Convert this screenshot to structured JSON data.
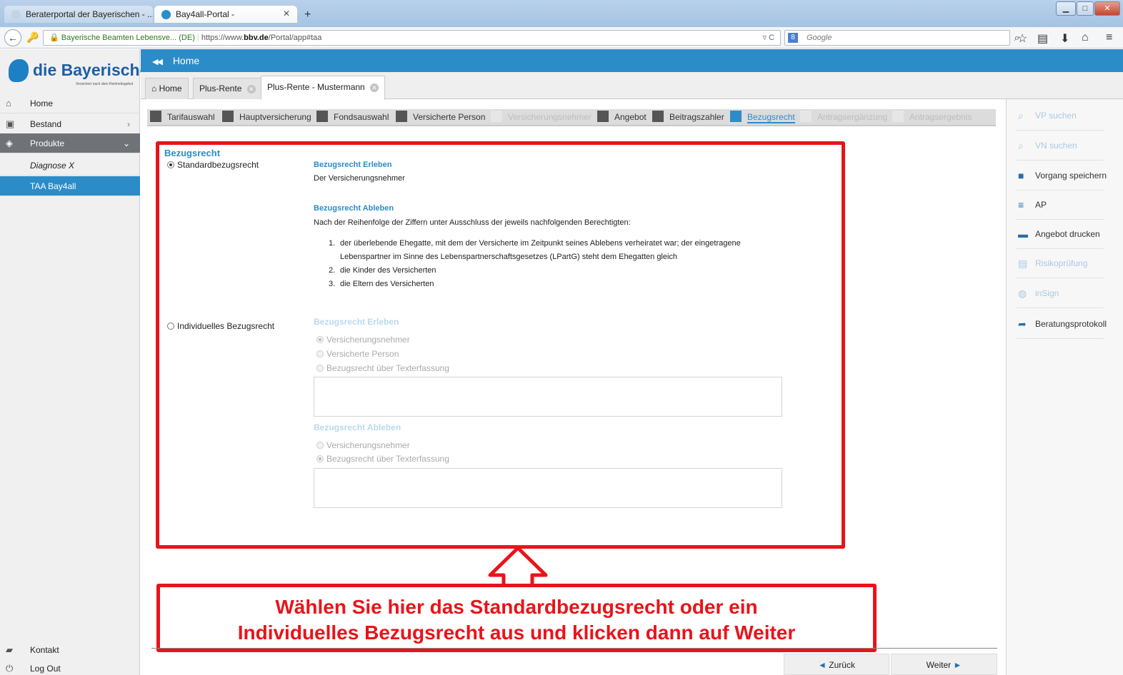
{
  "browser": {
    "tabs": [
      {
        "title": "Beraterportal der Bayerischen - ..."
      },
      {
        "title": "Bay4all-Portal -"
      }
    ],
    "new_tab": "+",
    "url_site": "Bayerische Beamten Lebensve... (DE)",
    "url_prefix": "https://www.",
    "url_domain": "bbv.de",
    "url_path": "/Portal/app#taa",
    "search_placeholder": "Google"
  },
  "sidebar": {
    "logo_name": "die Bayerische",
    "logo_claim": "Versichert nach dem Reinheitsgebot",
    "items": [
      {
        "label": "Home",
        "icon": "home-icon"
      },
      {
        "label": "Bestand",
        "icon": "folder-icon"
      },
      {
        "label": "Produkte",
        "icon": "layers-icon"
      },
      {
        "label": "Diagnose X"
      },
      {
        "label": "TAA Bay4all"
      }
    ],
    "bottom": [
      {
        "label": "Kontakt",
        "icon": "contact-icon"
      },
      {
        "label": "Log Out",
        "icon": "power-icon"
      }
    ]
  },
  "header": {
    "title": "Home"
  },
  "work_tabs": [
    {
      "label": "Home"
    },
    {
      "label": "Plus-Rente"
    },
    {
      "label": "Plus-Rente - Mustermann"
    }
  ],
  "steps": [
    {
      "label": "Tarifauswahl",
      "state": "done"
    },
    {
      "label": "Hauptversicherung",
      "state": "done"
    },
    {
      "label": "Fondsauswahl",
      "state": "done"
    },
    {
      "label": "Versicherte Person",
      "state": "done"
    },
    {
      "label": "Versicherungsnehmer",
      "state": "disabled"
    },
    {
      "label": "Angebot",
      "state": "done"
    },
    {
      "label": "Beitragszahler",
      "state": "done"
    },
    {
      "label": "Bezugsrecht",
      "state": "current"
    },
    {
      "label": "Antragsergänzung",
      "state": "disabled"
    },
    {
      "label": "Antragsergebnis",
      "state": "disabled"
    }
  ],
  "right_actions": [
    {
      "label": "VP suchen",
      "enabled": false
    },
    {
      "label": "VN suchen",
      "enabled": false
    },
    {
      "label": "Vorgang speichern",
      "enabled": true
    },
    {
      "label": "AP",
      "enabled": true
    },
    {
      "label": "Angebot drucken",
      "enabled": true
    },
    {
      "label": "Risikoprüfung",
      "enabled": false
    },
    {
      "label": "inSign",
      "enabled": false
    },
    {
      "label": "Beratungsprotokoll",
      "enabled": true
    }
  ],
  "content": {
    "title": "Bezugsrecht",
    "standard": {
      "radio_label": "Standardbezugsrecht",
      "erleben_heading": "Bezugsrecht Erleben",
      "erleben_text": "Der Versicherungsnehmer",
      "ableben_heading": "Bezugsrecht Ableben",
      "ableben_text": "Nach der Reihenfolge der Ziffern unter Ausschluss der jeweils nachfolgenden Berechtigten:",
      "list": [
        {
          "num": "1.",
          "lines": [
            "der überlebende Ehegatte, mit dem der Versicherte im Zeitpunkt seines Ablebens verheiratet war; der eingetragene",
            "Lebenspartner im Sinne des Lebenspartnerschaftsgesetzes (LPartG) steht dem Ehegatten gleich"
          ]
        },
        {
          "num": "2.",
          "lines": [
            "die Kinder des Versicherten"
          ]
        },
        {
          "num": "3.",
          "lines": [
            "die Eltern des Versicherten"
          ]
        }
      ]
    },
    "individual": {
      "radio_label": "Individuelles Bezugsrecht",
      "erleben_heading": "Bezugsrecht Erleben",
      "erleben_options": [
        "Versicherungsnehmer",
        "Versicherte Person",
        "Bezugsrecht über Texterfassung"
      ],
      "ableben_heading": "Bezugsrecht Ableben",
      "ableben_options": [
        "Versicherungsnehmer",
        "Bezugsrecht über Texterfassung"
      ]
    }
  },
  "callout": {
    "line1": "Wählen Sie hier das Standardbezugsrecht oder ein",
    "line2": "Individuelles Bezugsrecht aus und klicken dann auf Weiter"
  },
  "footer": {
    "back_label": "Zurück",
    "next_label": "Weiter"
  },
  "colors": {
    "accent": "#2b8cc8",
    "annotation_red": "#e8141a"
  }
}
